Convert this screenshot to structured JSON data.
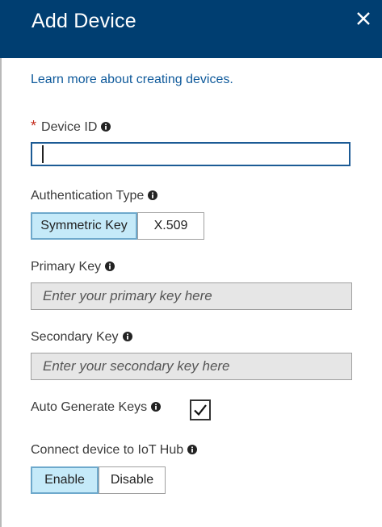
{
  "header": {
    "title": "Add Device",
    "close_icon": "close-icon"
  },
  "learn_more": "Learn more about creating devices.",
  "device_id": {
    "required_mark": "*",
    "label": "Device ID",
    "value": ""
  },
  "auth_type": {
    "label": "Authentication Type",
    "options": [
      "Symmetric Key",
      "X.509"
    ],
    "selected": "Symmetric Key"
  },
  "primary_key": {
    "label": "Primary Key",
    "placeholder": "Enter your primary key here"
  },
  "secondary_key": {
    "label": "Secondary Key",
    "placeholder": "Enter your secondary key here"
  },
  "auto_generate": {
    "label": "Auto Generate Keys",
    "checked": true
  },
  "connect": {
    "label": "Connect device to IoT Hub",
    "options": [
      "Enable",
      "Disable"
    ],
    "selected": "Enable"
  },
  "colors": {
    "header_bg": "#003e71",
    "link": "#0f5a9b",
    "active_segment": "#c5eaf9",
    "required": "#c42b1c"
  }
}
